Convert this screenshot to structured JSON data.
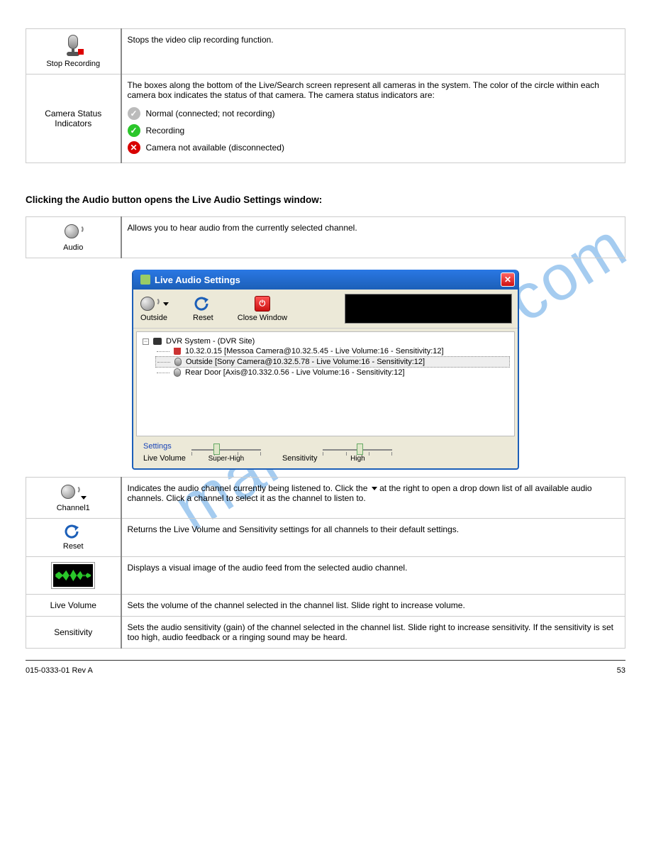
{
  "table1": {
    "stopRecordingIconLabel": "Stop Recording",
    "stopRecordingDesc": "Stops the video clip recording function.",
    "statusRowTitle": "Camera Status Indicators",
    "statusRowDesc": "The boxes along the bottom of the Live/Search screen represent all cameras in the system. The color of the circle within each camera box indicates the status of that camera. The camera status indicators are:",
    "statusGray": "Normal (connected; not recording)",
    "statusGreen": "Recording",
    "statusRed": "Camera not available (disconnected)"
  },
  "sectionTitle": "Clicking the Audio button opens the Live Audio Settings window:",
  "table2": {
    "audioIconLabel": "Audio",
    "audioDesc": "Allows you to hear audio from the currently selected channel."
  },
  "window": {
    "title": "Live Audio Settings",
    "outside": "Outside",
    "reset": "Reset",
    "closeWindow": "Close Window",
    "root": "DVR System - (DVR Site)",
    "item1": "10.32.0.15 [Messoa Camera@10.32.5.45 - Live Volume:16 - Sensitivity:12]",
    "item2": "Outside [Sony Camera@10.32.5.78 - Live Volume:16 - Sensitivity:12]",
    "item3": "Rear Door [Axis@10.332.0.56 - Live Volume:16 - Sensitivity:12]",
    "settingsLabel": "Settings",
    "liveVolLabel": "Live Volume",
    "liveVolSub": "Super-High",
    "sensLabel": "Sensitivity",
    "sensSub": "High"
  },
  "table3": {
    "channelIconLabel": "Channel1",
    "channelDesc1": "Indicates the audio channel currently being listened to. Click the ",
    "channelDesc2": " at the right to open a drop down list of all available audio channels. Click a channel to select it as the channel to listen to.",
    "resetIconLabel": "Reset",
    "resetDesc": "Returns the Live Volume and Sensitivity settings for all channels to their default settings.",
    "waveformDesc": "Displays a visual image of the audio feed from the selected audio channel.",
    "liveVolRowTitle": "Live Volume",
    "liveVolDesc": "Sets the volume of the channel selected in the channel list. Slide right to increase volume.",
    "sensRowTitle": "Sensitivity",
    "sensDesc": "Sets the audio sensitivity (gain) of the channel selected in the channel list. Slide right to increase sensitivity. If the sensitivity is set too high, audio feedback or a ringing sound may be heard."
  },
  "footer": {
    "left": "015-0333-01 Rev A",
    "right": "53"
  }
}
